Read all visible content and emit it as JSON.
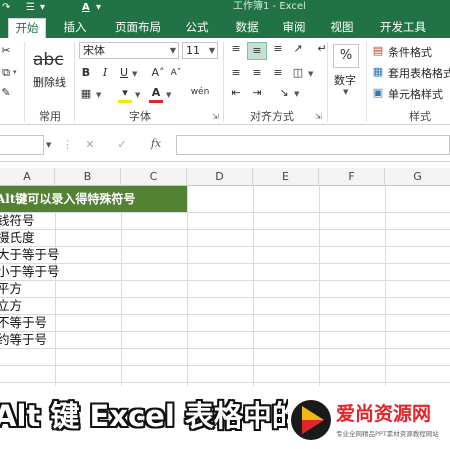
{
  "title_bar": {
    "title": "工作簿1 - Excel",
    "quick_access": [
      "↷",
      "☰",
      "▾",
      "A",
      "▾"
    ]
  },
  "ribbon_tabs": [
    "开始",
    "插入",
    "页面布局",
    "公式",
    "数据",
    "审阅",
    "视图",
    "开发工具"
  ],
  "ribbon": {
    "clipboard": {
      "label": "常用",
      "format_painter_hint": "▾"
    },
    "strike": {
      "label": "删除线"
    },
    "font": {
      "label": "字体",
      "name": "宋体",
      "size": "11",
      "bold": "B",
      "italic": "I",
      "underline": "U",
      "grow": "A˄",
      "shrink": "A˅",
      "phonetic": "wén"
    },
    "alignment": {
      "label": "对齐方式"
    },
    "number": {
      "label": "数字",
      "symbol": "%"
    },
    "styles": {
      "label": "样式",
      "conditional": "条件格式",
      "table": "套用表格格式",
      "cell": "单元格样式"
    }
  },
  "formula_bar": {
    "fx": "fx",
    "cancel": "✕",
    "enter": "✓"
  },
  "columns": [
    "A",
    "B",
    "C",
    "D",
    "E",
    "F",
    "G"
  ],
  "sheet": {
    "header": "Alt键可以录入得特殊符号",
    "rows": [
      "钱符号",
      "摄氏度",
      "大于等于号",
      "小于等于号",
      "平方",
      "立方",
      "不等于号",
      "约等于号"
    ]
  },
  "subtitle": "Alt 键 Excel 表格中的",
  "watermark": {
    "title": "爱尚资源网",
    "sub": "专业全网精品PPT素材资源教程网站"
  },
  "colors": {
    "excel_green": "#217346",
    "header_fill": "#548235",
    "logo_red": "#e3242b",
    "logo_yellow": "#f1b814"
  }
}
